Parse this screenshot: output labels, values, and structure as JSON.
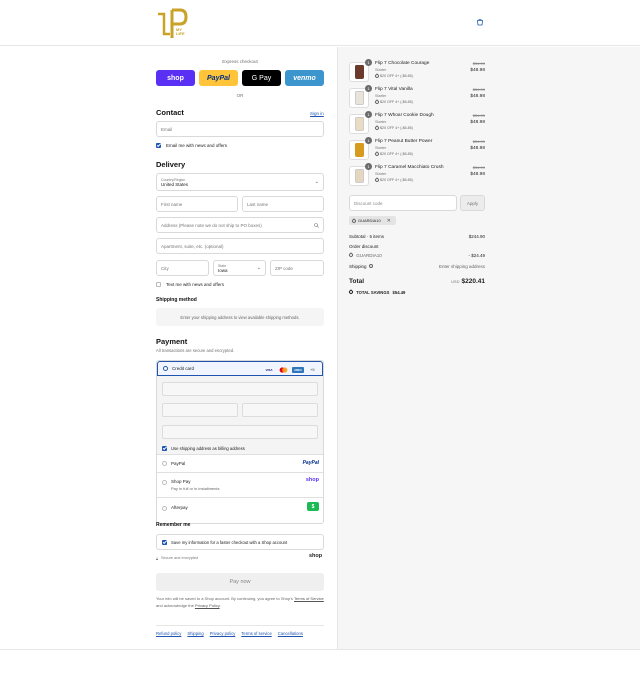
{
  "brand": {
    "logo_text": "P",
    "logo_sub": "MY LIFE",
    "logo_color": "#c9a227"
  },
  "express": {
    "title": "Express checkout",
    "buttons": [
      {
        "label": "shop",
        "bg": "#5a31f4",
        "fg": "#ffffff"
      },
      {
        "label": "PayPal",
        "bg": "#ffc439",
        "fg": "#003087"
      },
      {
        "label": "G Pay",
        "bg": "#000000",
        "fg": "#ffffff"
      },
      {
        "label": "venmo",
        "bg": "#3d95ce",
        "fg": "#ffffff"
      }
    ],
    "or": "OR"
  },
  "contact": {
    "heading": "Contact",
    "sign_in": "Sign in",
    "email_placeholder": "Email",
    "newsletter": "Email me with news and offers"
  },
  "delivery": {
    "heading": "Delivery",
    "country_label": "Country/Region",
    "country_value": "United States",
    "first_name": "First name",
    "last_name": "Last name",
    "address": "Address (Please note we do not ship to PO boxes)",
    "apartment": "Apartment, suite, etc. (optional)",
    "city": "City",
    "state_label": "State",
    "state_value": "Iowa",
    "zip": "ZIP code",
    "text_me": "Text me with news and offers"
  },
  "shipping_method": {
    "heading": "Shipping method",
    "message": "Enter your shipping address to view available shipping methods."
  },
  "payment": {
    "heading": "Payment",
    "subtitle": "All transactions are secure and encrypted.",
    "credit_card": "Credit card",
    "card_brands": [
      "VISA",
      "MC",
      "AMEX"
    ],
    "more_cards": "+5",
    "billing_same": "Use shipping address as billing address",
    "paypal": "PayPal",
    "paypal_logo": "PayPal",
    "shop_pay": "Shop Pay",
    "shop_pay_sub": "Pay in full or in installments",
    "shop_logo": "shop",
    "afterpay": "Afterpay",
    "afterpay_logo": "$"
  },
  "remember": {
    "heading": "Remember me",
    "save_label": "Save my information for a faster checkout with a Shop account",
    "secure": "Secure and encrypted",
    "shop_logo": "shop"
  },
  "pay_button": "Pay now",
  "legal": {
    "text1": "Your info will be saved to a Shop account. By continuing, you agree to Shop's",
    "terms": "Terms of Service",
    "text2": "and acknowledge the",
    "privacy": "Privacy Policy",
    "end": "."
  },
  "footer_links": [
    "Refund policy",
    "Shipping",
    "Privacy policy",
    "Terms of service",
    "Cancellations"
  ],
  "cart": {
    "items": [
      {
        "name": "Flip 7 Chocolate Courage",
        "variant": "Starter",
        "discount": "$20 OFF 4+ (-$6.85)",
        "old_price": "$54.99",
        "price": "$48.98",
        "qty": "1",
        "color": "#6b3a2a"
      },
      {
        "name": "Flip 7 Vital Vanilla",
        "variant": "Starter",
        "discount": "$20 OFF 4+ (-$6.85)",
        "old_price": "$54.99",
        "price": "$48.98",
        "qty": "1",
        "color": "#e8e4da"
      },
      {
        "name": "Flip 7 Whoa! Cookie Dough",
        "variant": "Starter",
        "discount": "$20 OFF 4+ (-$6.85)",
        "old_price": "$54.99",
        "price": "$48.98",
        "qty": "1",
        "color": "#eadcc3"
      },
      {
        "name": "Flip 7 Peanut Butter Power",
        "variant": "Starter",
        "discount": "$20 OFF 4+ (-$6.85)",
        "old_price": "$54.99",
        "price": "$48.98",
        "qty": "1",
        "color": "#d79b1f"
      },
      {
        "name": "Flip 7 Caramel Macchiato Crush",
        "variant": "Starter",
        "discount": "$20 OFF 4+ (-$6.85)",
        "old_price": "$54.99",
        "price": "$48.98",
        "qty": "1",
        "color": "#e6d6c0"
      }
    ],
    "discount_placeholder": "Discount code",
    "apply": "Apply",
    "code_chip": "GUARDIA10",
    "subtotal_label": "Subtotal · 5 items",
    "subtotal": "$244.90",
    "order_discount": "Order discount",
    "code": "GUARDIA10",
    "code_amount": "- $24.49",
    "shipping_label": "Shipping",
    "shipping_value": "Enter shipping address",
    "total_label": "Total",
    "currency": "USD",
    "total": "$220.41",
    "savings_label": "TOTAL SAVINGS",
    "savings": "$54.49"
  }
}
